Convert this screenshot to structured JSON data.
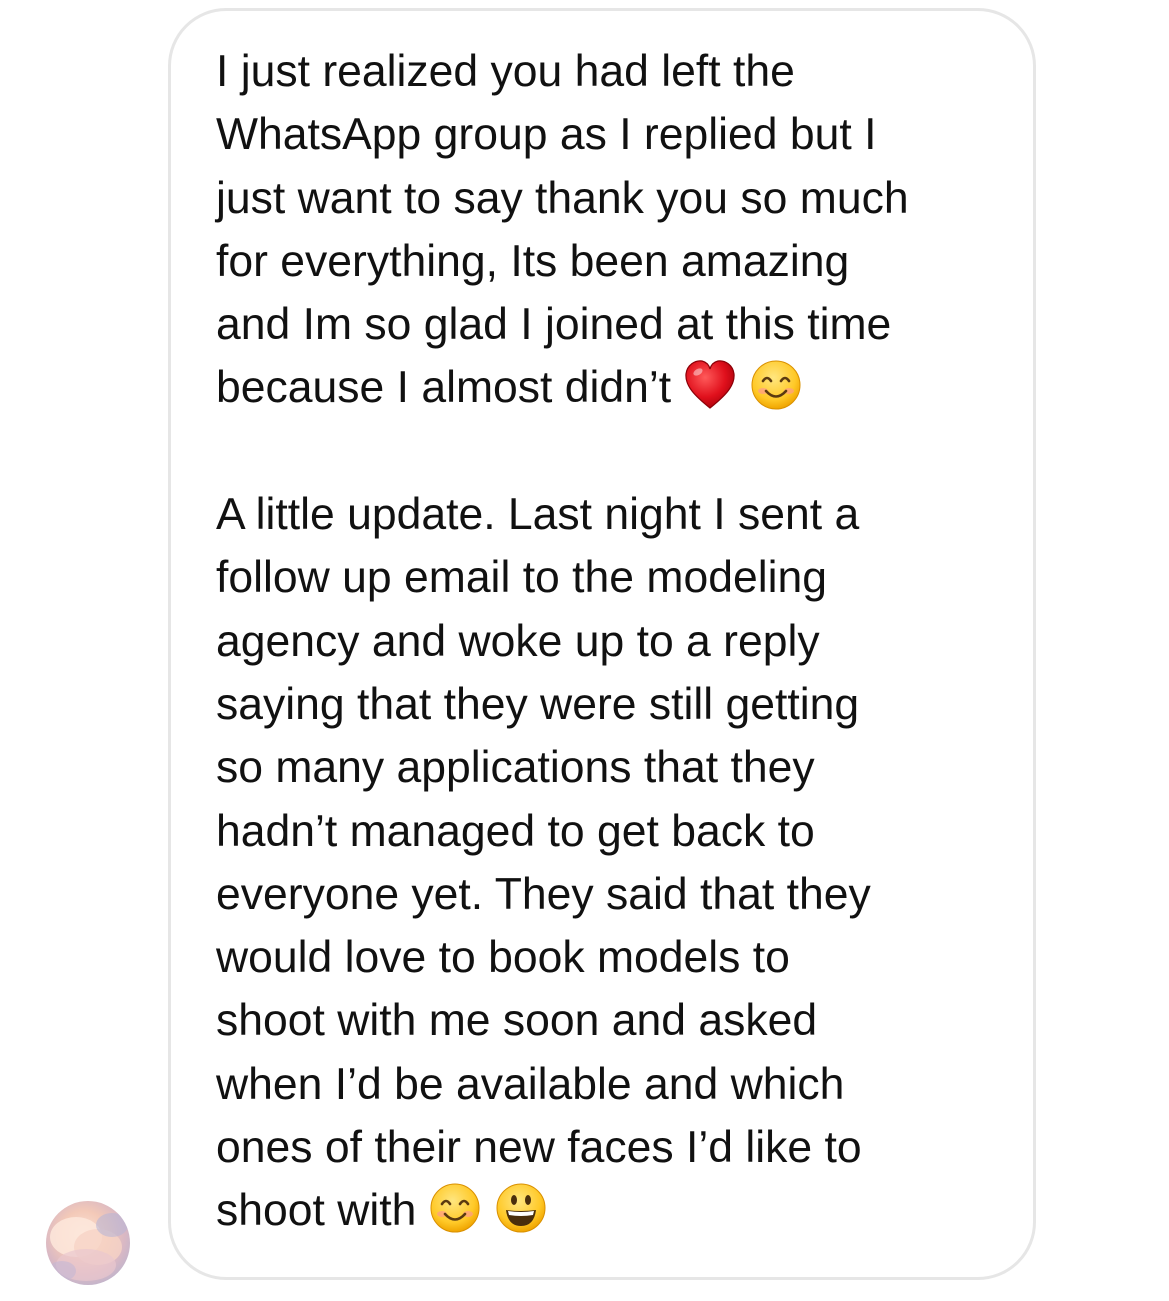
{
  "message": {
    "paragraph1": [
      "I just realized you had left the",
      "WhatsApp group as I replied but I",
      "just want to say thank you so much",
      "for everything, Its been amazing",
      "and Im so glad I joined at this time",
      "because I almost didn’t"
    ],
    "paragraph2": [
      "A little update. Last night I sent a",
      "follow up email to the modeling",
      "agency and woke up to a reply",
      "saying that they were still getting",
      "so many applications that they",
      "hadn’t managed to get back to",
      "everyone yet. They said that they",
      "would love to book models to",
      "shoot with me soon and asked",
      "when I’d be available and which",
      "ones of their new faces I’d like to",
      "shoot with"
    ],
    "emojis_end_p1": [
      "red-heart",
      "smiling-face-with-smiling-eyes"
    ],
    "emojis_end_p2": [
      "smiling-face-with-smiling-eyes",
      "grinning-face-with-big-eyes"
    ]
  },
  "colors": {
    "text": "#111111",
    "bubble_border": "#e6e6e6",
    "background": "#ffffff"
  }
}
